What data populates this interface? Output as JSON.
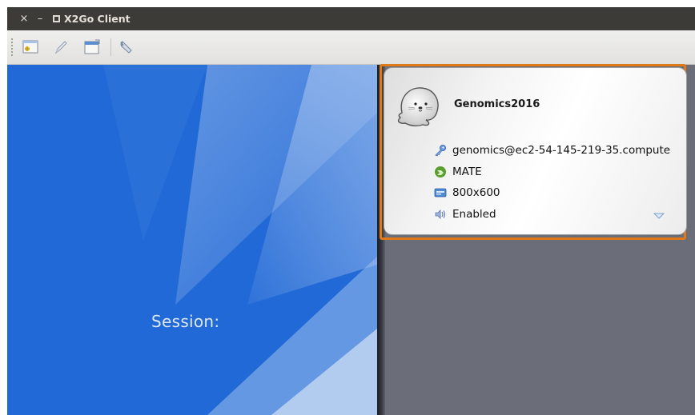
{
  "window": {
    "title": "X2Go Client",
    "controls": {
      "close": "×",
      "minimize": "–",
      "maximize": "▫"
    }
  },
  "toolbar": {
    "items": [
      {
        "icon": "new-session-icon"
      },
      {
        "icon": "edit-session-icon"
      },
      {
        "icon": "session-window-icon"
      },
      {
        "icon": "settings-wrench-icon"
      }
    ]
  },
  "login_panel": {
    "session_label": "Session:"
  },
  "session_card": {
    "name": "Genomics2016",
    "server": "genomics@ec2-54-145-219-35.compute",
    "desktop": "MATE",
    "resolution": "800x600",
    "sound": "Enabled",
    "highlight_color": "#e07a18"
  },
  "colors": {
    "login_background": "#2169d6",
    "sessions_background": "#6b6e78",
    "titlebar": "#3c3b37"
  }
}
